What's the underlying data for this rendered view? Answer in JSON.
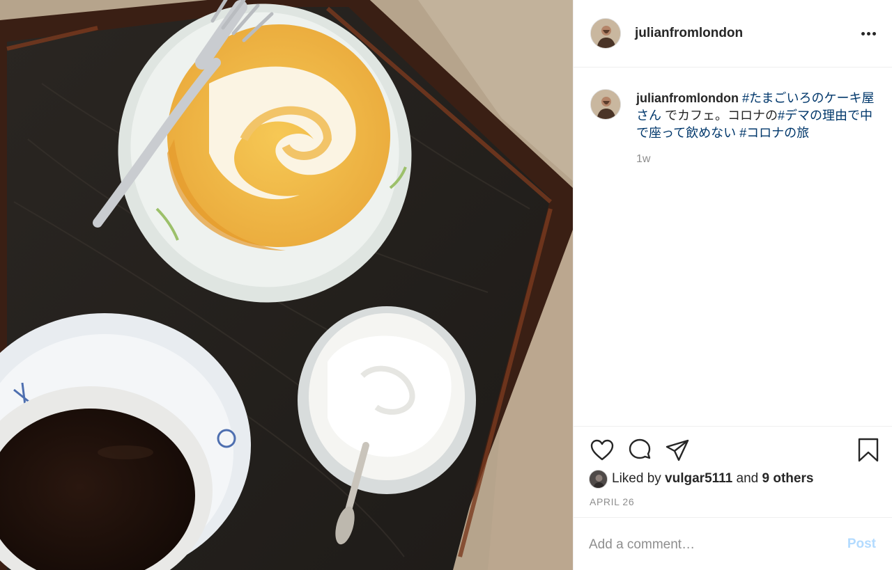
{
  "post": {
    "username": "julianfromlondon",
    "more_icon": "more-horizontal-icon",
    "image_alt": "Roll cake, whipped cream cup and black coffee on a wooden tray"
  },
  "caption": {
    "username": "julianfromlondon",
    "segments": [
      {
        "text": "#たまごいろのケーキ屋さん",
        "type": "hashtag"
      },
      {
        "text": " でカフェ。コロナの",
        "type": "text"
      },
      {
        "text": "#デマの理由で中で座って飲めない",
        "type": "hashtag"
      },
      {
        "text": " ",
        "type": "text"
      },
      {
        "text": "#コロナの旅",
        "type": "hashtag"
      }
    ],
    "time": "1w"
  },
  "actions": {
    "icons": [
      "heart-icon",
      "comment-icon",
      "share-icon",
      "bookmark-icon"
    ]
  },
  "likes": {
    "prefix": "Liked by ",
    "user": "vulgar5111",
    "middle": " and ",
    "others": "9 others"
  },
  "date": "APRIL 26",
  "comment": {
    "placeholder": "Add a comment…",
    "post_label": "Post"
  },
  "colors": {
    "hashtag": "#00376b",
    "secondary_text": "#8e8e8e",
    "post_disabled": "#b3dbff",
    "divider": "#efefef"
  }
}
